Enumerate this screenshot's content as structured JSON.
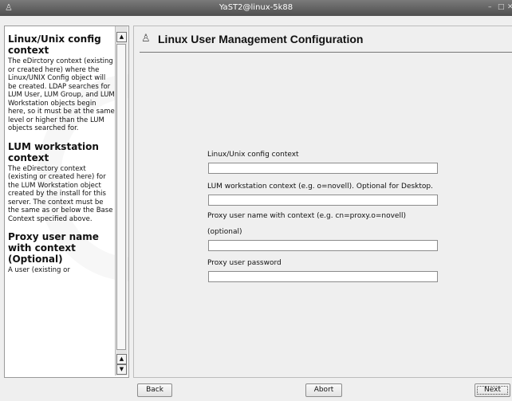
{
  "window": {
    "title": "YaST2@linux-5k88"
  },
  "help": {
    "sections": [
      {
        "heading": "Linux/Unix config context",
        "text": "The eDirctory context (existing or created here) where the Linux/UNIX Config object will be created. LDAP searches for LUM User, LUM Group, and LUM Workstation objects begin here, so it must be at the same level or higher than the LUM objects searched for."
      },
      {
        "heading": "LUM workstation context",
        "text": "The eDirectory context (existing or created here) for the LUM Workstation object created by the install for this server. The context must be the same as or below the Base Context specified above."
      },
      {
        "heading": "Proxy user name with context (Optional)",
        "text": "A user (existing or"
      }
    ]
  },
  "main": {
    "title": "Linux User Management Configuration",
    "fields": [
      {
        "label": "Linux/Unix config context",
        "value": ""
      },
      {
        "label": "LUM workstation context (e.g. o=novell). Optional for Desktop.",
        "value": ""
      },
      {
        "label": "Proxy user name with context (e.g. cn=proxy.o=novell)",
        "label2": "(optional)",
        "value": ""
      },
      {
        "label": "Proxy user password",
        "value": ""
      }
    ]
  },
  "buttons": {
    "back": "Back",
    "abort": "Abort",
    "next": "Next"
  },
  "icons": {
    "app": "yast-user-icon",
    "header": "user-management-icon",
    "minimize": "minimize-icon",
    "maximize": "maximize-icon",
    "close": "close-icon"
  }
}
